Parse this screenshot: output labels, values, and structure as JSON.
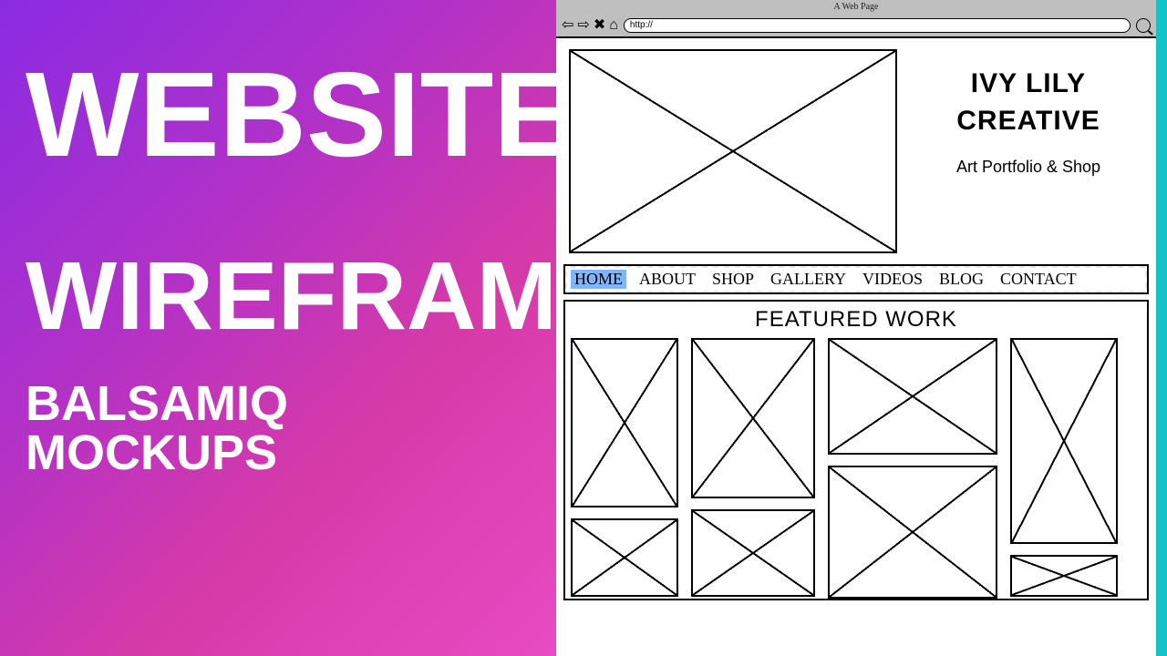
{
  "left_panel": {
    "title_line1": "WEBSITE",
    "title_line2": "WIREFRAME",
    "subtitle": "BALSAMIQ MOCKUPS"
  },
  "browser": {
    "window_title": "A Web Page",
    "url_prefix": "http://",
    "icons": {
      "back": "back-arrow-icon",
      "fwd": "forward-arrow-icon",
      "stop": "stop-icon",
      "home": "home-icon",
      "search": "search-icon"
    }
  },
  "site": {
    "brand_line1": "IVY LILY",
    "brand_line2": "CREATIVE",
    "tagline": "Art Portfolio & Shop"
  },
  "nav": {
    "items": [
      "HOME",
      "ABOUT",
      "SHOP",
      "GALLERY",
      "VIDEOS",
      "BLOG",
      "CONTACT"
    ],
    "active_index": 0
  },
  "featured": {
    "heading": "FEATURED WORK"
  }
}
